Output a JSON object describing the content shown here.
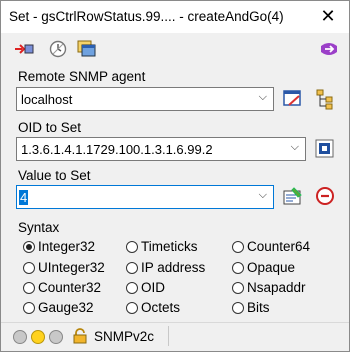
{
  "window": {
    "title": "Set - gsCtrlRowStatus.99.... - createAndGo(4)"
  },
  "toolbar": {
    "icons": [
      "set-request-icon",
      "stopwatch-icon",
      "window-list-icon",
      "help-icon"
    ]
  },
  "agent": {
    "label": "Remote SNMP agent",
    "value": "localhost"
  },
  "oid": {
    "label": "OID to Set",
    "value": "1.3.6.1.4.1.1729.100.1.3.1.6.99.2"
  },
  "value_to_set": {
    "label": "Value to Set",
    "value": "4"
  },
  "syntax": {
    "label": "Syntax",
    "selected": "Integer32",
    "options": [
      "Integer32",
      "Timeticks",
      "Counter64",
      "UInteger32",
      "IP address",
      "Opaque",
      "Counter32",
      "OID",
      "Nsapaddr",
      "Gauge32",
      "Octets",
      "Bits"
    ]
  },
  "status": {
    "version": "SNMPv2c",
    "lights": [
      "#c8c8c8",
      "#ffd21e",
      "#c8c8c8"
    ]
  }
}
